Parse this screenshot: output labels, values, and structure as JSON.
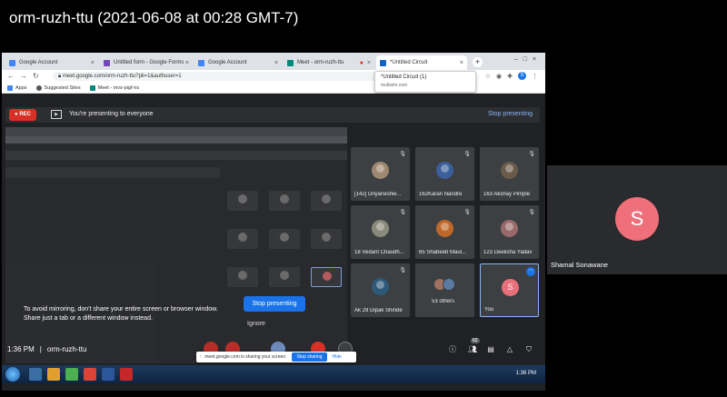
{
  "recording_title": "orm-ruzh-ttu (2021-06-08 at 00:28 GMT-7)",
  "browser": {
    "tabs": [
      {
        "label": "Google Account",
        "color": "#4285f4"
      },
      {
        "label": "Untitled form - Google Forms",
        "color": "#7248b9"
      },
      {
        "label": "Google Account",
        "color": "#4285f4"
      },
      {
        "label": "Meet - orm-ruzh-ttu",
        "color": "#00897b"
      },
      {
        "label": "*Untitled Circuit",
        "color": "#1565c0"
      }
    ],
    "tooltip_title": "*Untitled Circuit (1)",
    "tooltip_domain": "multisim.com",
    "url": "meet.google.com/orm-ruzh-ttu?pli=1&authuser=1",
    "profile_letter": "S",
    "bookmarks": [
      "Apps",
      "Suggested Sites",
      "Meet - mvs-pigf-irs"
    ]
  },
  "meet": {
    "rec_label": "REC",
    "presenting_text": "You're presenting to everyone",
    "stop_presenting_link": "Stop presenting",
    "mirror_warning": "To avoid mirroring, don't share your entire screen or browser window. Share just a tab or a different window instead.",
    "stop_presenting_button": "Stop presenting",
    "ignore_button": "Ignore",
    "time": "1:36 PM",
    "meeting_code": "orm-ruzh-ttu",
    "people_count": "62",
    "participants": [
      {
        "name": "[142] Dnyaneshw..."
      },
      {
        "name": "162Karan Nandre"
      },
      {
        "name": "163 Akshay Pimple"
      },
      {
        "name": "18 Vedant Chaudh..."
      },
      {
        "name": "65 Shabeeb Maul..."
      },
      {
        "name": "123 Deeksha Yadav"
      },
      {
        "name": "Ak 29 Dipak Shinde"
      },
      {
        "name": "53 others"
      },
      {
        "name": "You"
      }
    ],
    "you_letter": "S"
  },
  "share_notice": {
    "text": "meet.google.com is sharing your screen.",
    "stop_button": "Stop sharing",
    "hide_button": "Hide"
  },
  "taskbar": {
    "clock": "1:36 PM"
  },
  "side_participant": {
    "letter": "S",
    "name": "Shamal Sonawane"
  }
}
